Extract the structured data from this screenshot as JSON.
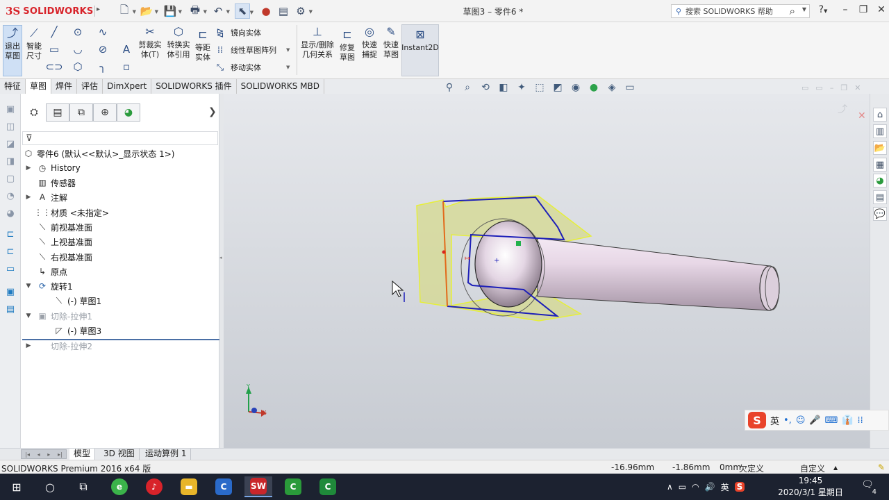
{
  "app": {
    "brand": "SOLIDWORKS",
    "doc_title": "草图3 – 零件6 *",
    "help_search_placeholder": "搜索 SOLIDWORKS 帮助"
  },
  "command_manager": {
    "exit_sketch": "退出\n草图",
    "smart_dim": "智能\n尺寸",
    "trim": "剪裁实\n体(T)",
    "convert": "转换实\n体引用",
    "offset": "等距\n实体",
    "mirror": "镜向实体",
    "linear_pattern": "线性草图阵列",
    "move": "移动实体",
    "display_relations": "显示/删除\n几何关系",
    "repair": "修复\n草图",
    "quick_snaps": "快速\n捕捉",
    "rapid_sketch": "快速\n草图",
    "instant2d": "Instant2D"
  },
  "tabs": [
    "特征",
    "草图",
    "焊件",
    "评估",
    "DimXpert",
    "SOLIDWORKS 插件",
    "SOLIDWORKS MBD"
  ],
  "active_tab": "草图",
  "feature_tree": {
    "root": "零件6 (默认<<默认>_显示状态 1>)",
    "items": [
      {
        "label": "History",
        "icon": "history-icon"
      },
      {
        "label": "传感器",
        "icon": "sensor-icon"
      },
      {
        "label": "注解",
        "icon": "annotation-icon"
      },
      {
        "label": "材质 <未指定>",
        "icon": "material-icon"
      },
      {
        "label": "前视基准面",
        "icon": "plane-icon"
      },
      {
        "label": "上视基准面",
        "icon": "plane-icon"
      },
      {
        "label": "右视基准面",
        "icon": "plane-icon"
      },
      {
        "label": "原点",
        "icon": "origin-icon"
      },
      {
        "label": "旋转1",
        "icon": "revolve-icon"
      },
      {
        "label": "(-) 草图1",
        "icon": "sketch-icon"
      },
      {
        "label": "切除-拉伸1",
        "icon": "cut-extrude-icon"
      },
      {
        "label": "(-) 草图3",
        "icon": "sketch-icon"
      },
      {
        "label": "切除-拉伸2",
        "icon": "cut-extrude-icon"
      }
    ]
  },
  "model_tabs": [
    "模型",
    "3D 视图",
    "运动算例 1"
  ],
  "status": {
    "product": "SOLIDWORKS Premium 2016 x64 版",
    "x": "-16.96mm",
    "y": "-1.86mm",
    "z": "0mm",
    "defined": "欠定义",
    "units": "自定义"
  },
  "ime": {
    "lang": "英"
  },
  "axis": {
    "y": "Y",
    "x": "X"
  },
  "taskbar": {
    "time": "19:45",
    "date": "2020/3/1 星期日",
    "tray_lang": "英",
    "notif_count": "4"
  },
  "colors": {
    "accent": "#d8232a",
    "sketch_line": "#1d1fb8",
    "highlight": "#e6ef3a",
    "taskbar": "#1c2230"
  }
}
